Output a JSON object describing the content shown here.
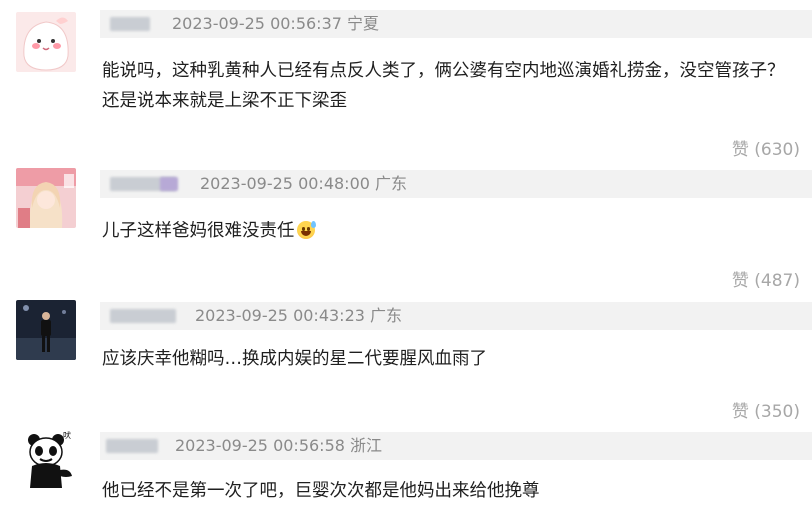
{
  "comments": [
    {
      "time": "2023-09-25 00:56:37",
      "location": "宁夏",
      "text": "能说吗，这种乳黄种人已经有点反人类了，俩公婆有空内地巡演婚礼捞金，没空管孩子？还是说本来就是上梁不正下梁歪",
      "likes": "赞 (630)",
      "avatar_icon": "pink-cartoon-avatar"
    },
    {
      "time": "2023-09-25 00:48:00",
      "location": "广东",
      "text": "儿子这样爸妈很难没责任",
      "emoji": "sweat-smile-emoji",
      "likes": "赞 (487)",
      "avatar_icon": "girl-photo-avatar"
    },
    {
      "time": "2023-09-25 00:43:23",
      "location": "广东",
      "text": "应该庆幸他糊吗…换成内娱的星二代要腥风血雨了",
      "likes": "赞 (350)",
      "avatar_icon": "night-photo-avatar"
    },
    {
      "time": "2023-09-25 00:56:58",
      "location": "浙江",
      "text": "他已经不是第一次了吧，巨婴次次都是他妈出来给他挽尊",
      "avatar_icon": "panda-meme-avatar"
    }
  ],
  "colors": {
    "meta_bg": "#f2f2f2",
    "meta_text": "#8a8a8a",
    "likes_text": "#a7a7a7"
  }
}
